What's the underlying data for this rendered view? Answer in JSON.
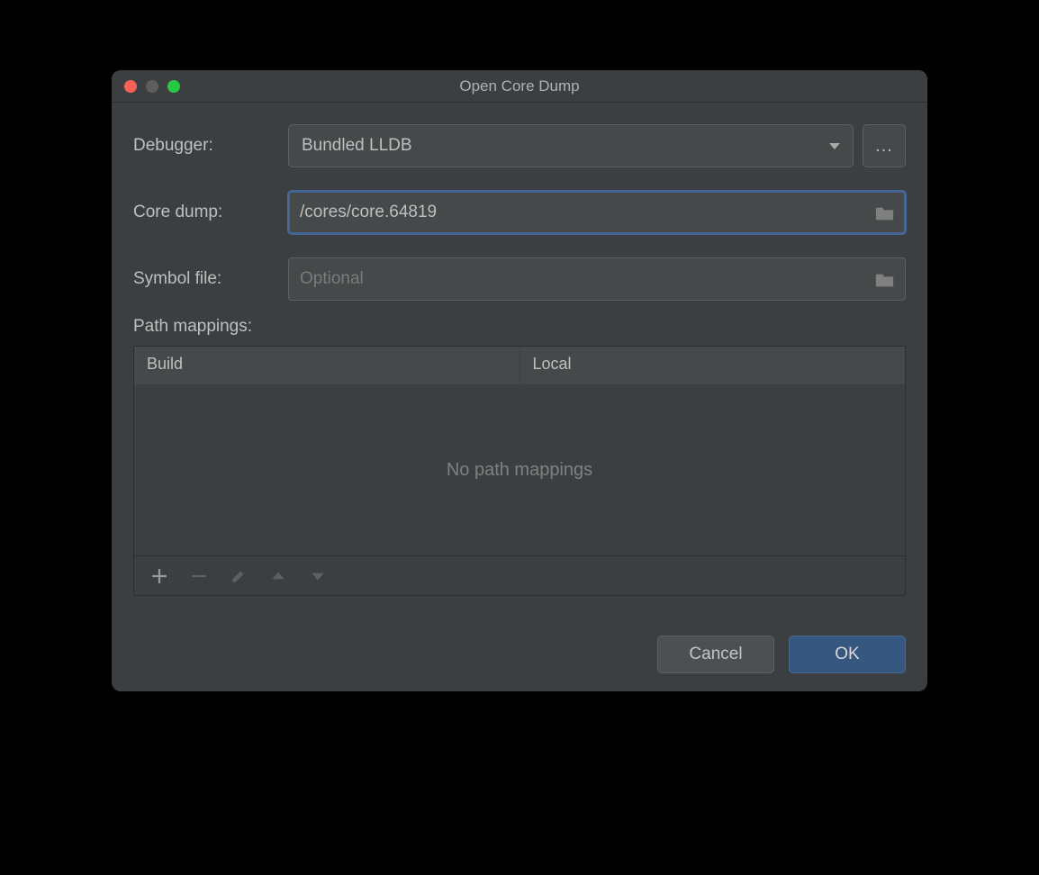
{
  "window": {
    "title": "Open Core Dump"
  },
  "form": {
    "debugger": {
      "label": "Debugger:",
      "value": "Bundled LLDB",
      "more": "..."
    },
    "coredump": {
      "label": "Core dump:",
      "value": "/cores/core.64819"
    },
    "symbolfile": {
      "label": "Symbol file:",
      "placeholder": "Optional",
      "value": ""
    },
    "pathmappings": {
      "label": "Path mappings:",
      "columns": [
        "Build",
        "Local"
      ],
      "empty": "No path mappings"
    }
  },
  "buttons": {
    "cancel": "Cancel",
    "ok": "OK"
  }
}
